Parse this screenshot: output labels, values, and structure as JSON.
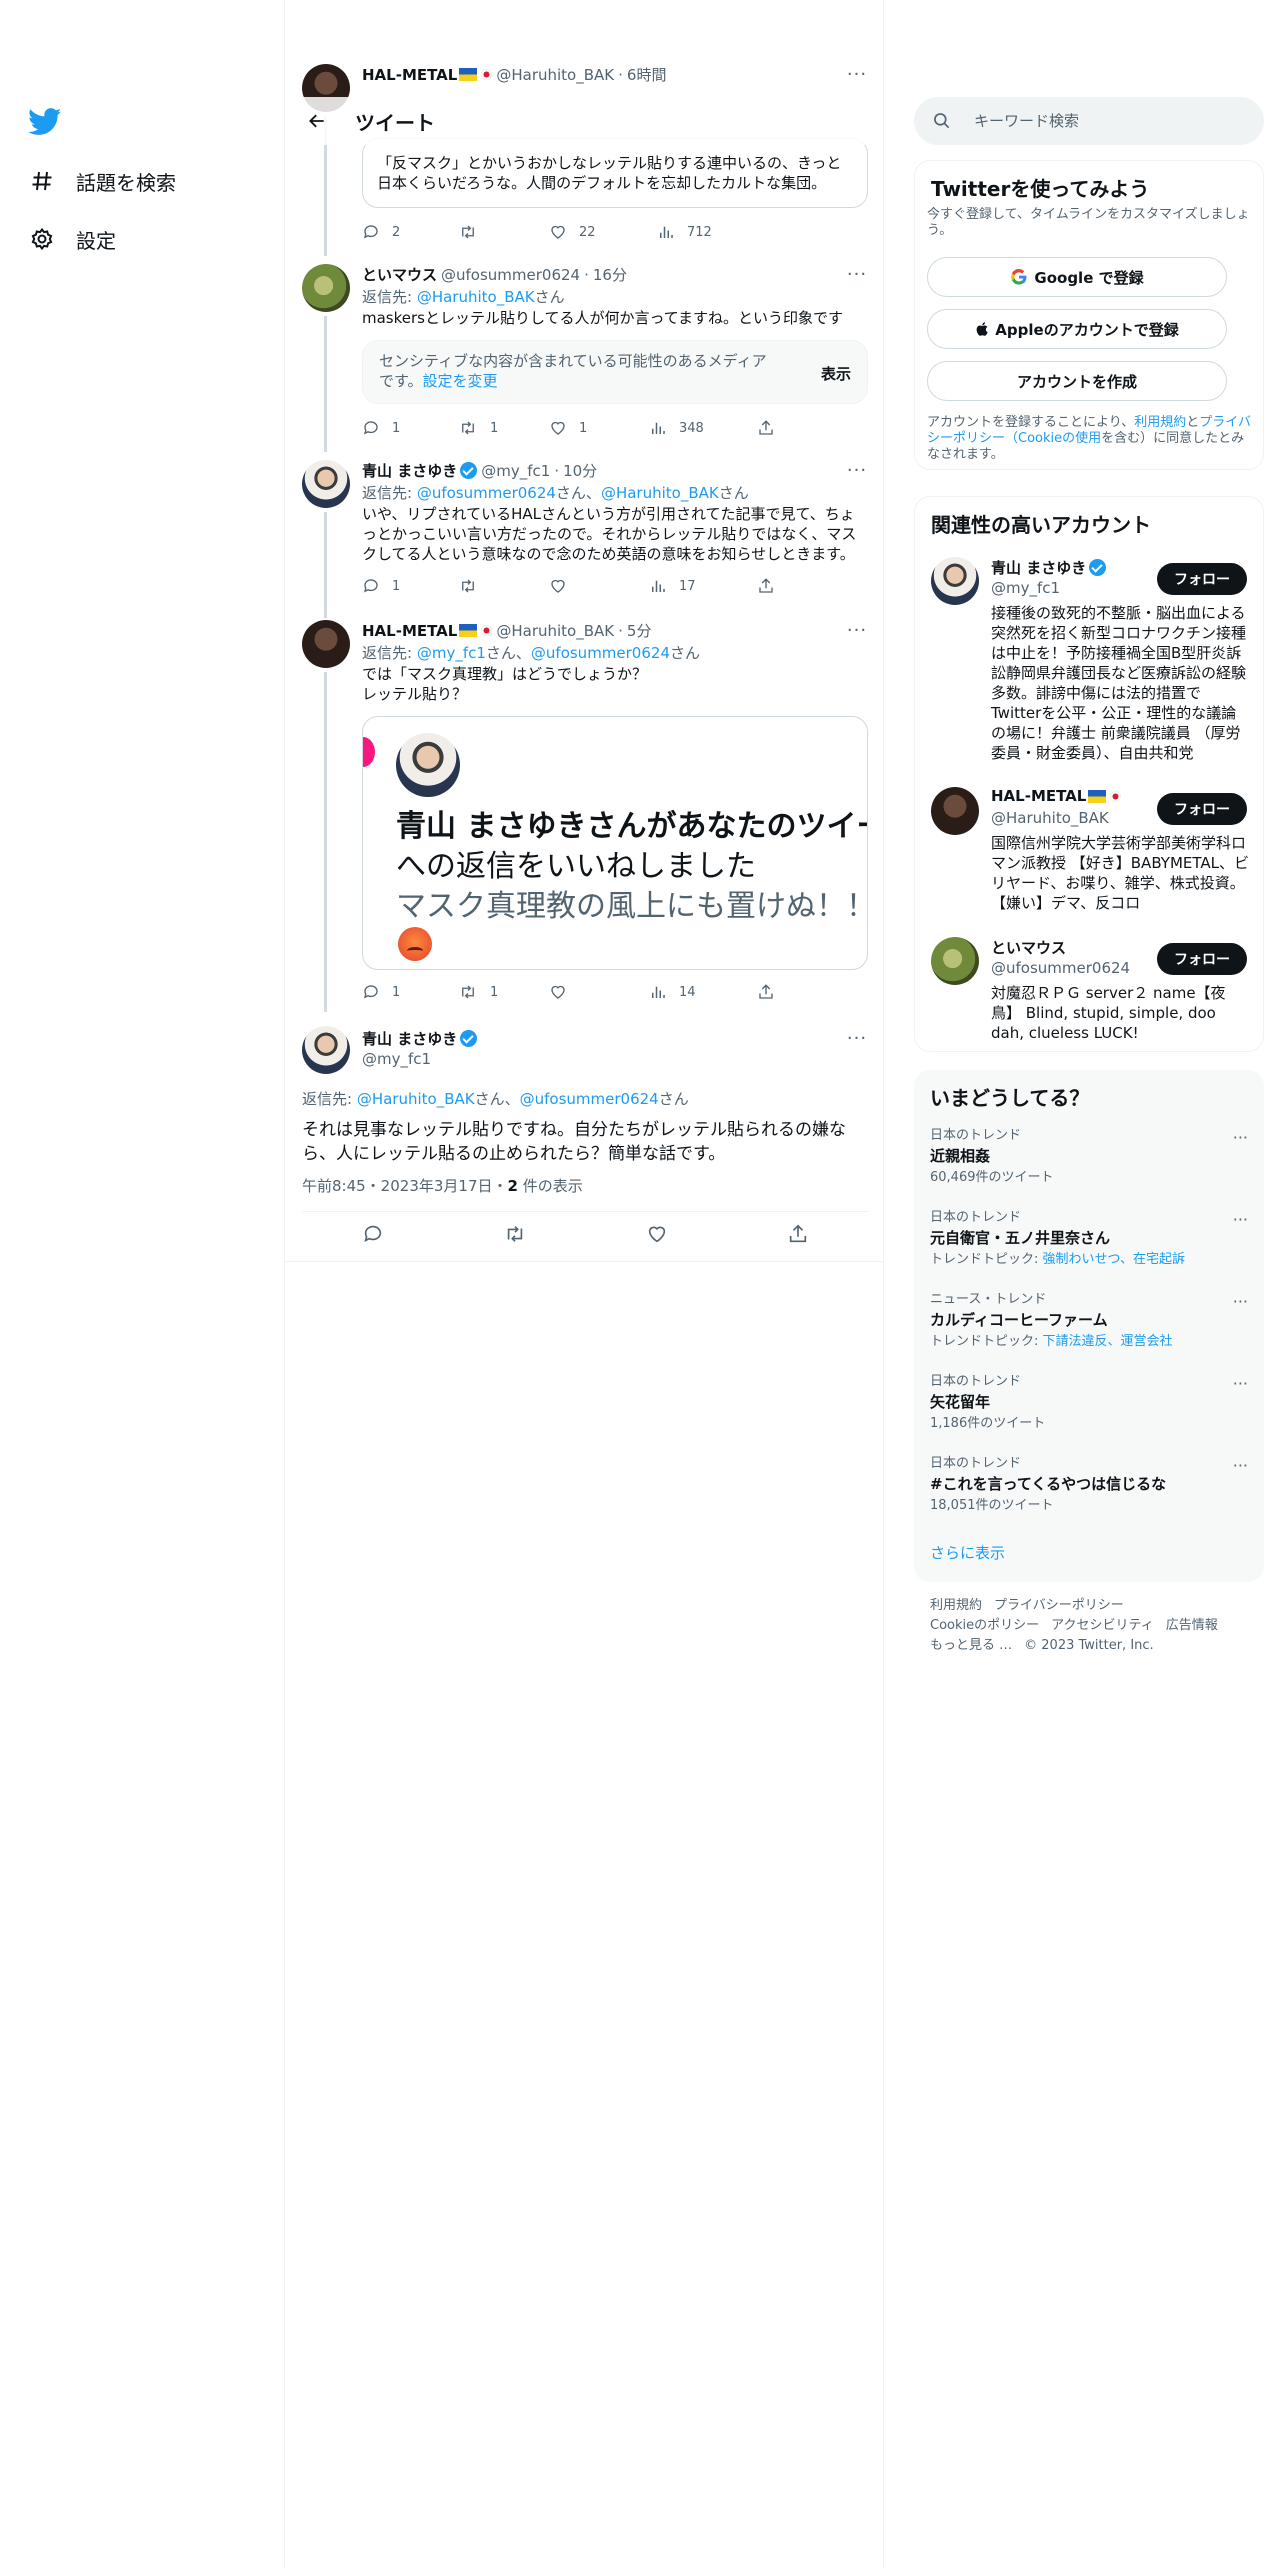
{
  "nav": {
    "explore": "話題を検索",
    "settings": "設定"
  },
  "header": {
    "title": "ツイート"
  },
  "thread": {
    "t1": {
      "name": "HAL-METAL",
      "handle": "@Haruhito_BAK",
      "time": "6時間",
      "quote_text": "「反マスク」とかいうおかしなレッテル貼りする連中いるの、きっと日本くらいだろうな。人間のデフォルトを忘却したカルトな集団。",
      "replies": "2",
      "retweets": "",
      "likes": "22",
      "views": "712"
    },
    "t2": {
      "name": "といマウス",
      "handle": "@ufosummer0624",
      "time": "16分",
      "reply_prefix": "返信先: ",
      "reply_link": "@Haruhito_BAK",
      "reply_suffix": "さん",
      "body": "maskersとレッテル貼りしてる人が何か言ってますね。という印象です",
      "sensitive_text": "センシティブな内容が含まれている可能性のあるメディアです。",
      "sensitive_link": "設定を変更",
      "show": "表示",
      "replies": "1",
      "retweets": "1",
      "likes": "1",
      "views": "348"
    },
    "t3": {
      "name": "青山 まさゆき",
      "handle": "@my_fc1",
      "time": "10分",
      "reply_prefix": "返信先: ",
      "reply_link1": "@ufosummer0624",
      "reply_mid": "さん、",
      "reply_link2": "@Haruhito_BAK",
      "reply_suffix": "さん",
      "body": "いや、リプされているHALさんという方が引用されてた記事で見て、ちょっとかっこいい言い方だったので。それからレッテル貼りではなく、マスクしてる人という意味なので念のため英語の意味をお知らせしときます。",
      "replies": "1",
      "retweets": "",
      "likes": "",
      "views": "17"
    },
    "t4": {
      "name": "HAL-METAL",
      "handle": "@Haruhito_BAK",
      "time": "5分",
      "reply_prefix": "返信先: ",
      "reply_link1": "@my_fc1",
      "reply_mid": "さん、",
      "reply_link2": "@ufosummer0624",
      "reply_suffix": "さん",
      "body_line1": "では「マスク真理教」はどうでしょうか？",
      "body_line2": "レッテル貼り？",
      "img_line1": "青山 まさゆきさんがあなたのツイー",
      "img_line2": "への返信をいいねしました",
      "img_line3": "マスク真理教の風上にも置けぬ！！",
      "replies": "1",
      "retweets": "1",
      "likes": "",
      "views": "14"
    },
    "main": {
      "name": "青山 まさゆき",
      "handle": "@my_fc1",
      "reply_prefix": "返信先: ",
      "reply_link1": "@Haruhito_BAK",
      "reply_mid": "さん、",
      "reply_link2": "@ufosummer0624",
      "reply_suffix": "さん",
      "body": "それは見事なレッテル貼りですね。自分たちがレッテル貼られるの嫌なら、人にレッテル貼るの止められたら？簡単な話です。",
      "time": "午前8:45・2023年3月17日・",
      "views_count": "2",
      "views_label": " 件の表示"
    }
  },
  "right": {
    "search_placeholder": "キーワード検索",
    "signup": {
      "title": "Twitterを使ってみよう",
      "subtitle": "今すぐ登録して、タイムラインをカスタマイズしましょう。",
      "google": "Google で登録",
      "apple": "Appleのアカウントで登録",
      "create": "アカウントを作成",
      "terms_1": "アカウントを登録することにより、",
      "terms_link1": "利用規約",
      "terms_2": "と",
      "terms_link2": "プライバシーポリシー（Cookieの使用",
      "terms_3": "を含む）に同意したとみなされます。"
    },
    "related": {
      "title": "関連性の高いアカウント",
      "follow": "フォロー",
      "accounts": [
        {
          "name": "青山 まさゆき",
          "handle": "@my_fc1",
          "bio": "接種後の致死的不整脈・脳出血による突然死を招く新型コロナワクチン接種は中止を！予防接種禍全国B型肝炎訴訟静岡県弁護団長など医療訴訟の経験多数。誹謗中傷には法的措置でTwitterを公平・公正・理性的な議論の場に！弁護士 前衆議院議員 （厚労委員・財金委員）、自由共和党"
        },
        {
          "name": "HAL-METAL",
          "handle": "@Haruhito_BAK",
          "bio": "国際信州学院大学芸術学部美術学科ロマン派教授 【好き】BABYMETAL、ビリヤード、お喋り、雑学、株式投資。【嫌い】デマ、反コロ"
        },
        {
          "name": "といマウス",
          "handle": "@ufosummer0624",
          "bio": "対魔忍ＲＰＧ server２ name【夜鳥】 Blind, stupid, simple, doo dah, clueless LUCK!"
        }
      ]
    },
    "trends": {
      "title": "いまどうしてる？",
      "items": [
        {
          "cat": "日本のトレンド",
          "name": "近親相姦",
          "sub": "60,469件のツイート"
        },
        {
          "cat": "日本のトレンド",
          "name": "元自衛官・五ノ井里奈さん",
          "sub_prefix": "トレンドトピック: ",
          "sub_link": "強制わいせつ、在宅起訴"
        },
        {
          "cat": "ニュース・トレンド",
          "name": "カルディコーヒーファーム",
          "sub_prefix": "トレンドトピック: ",
          "sub_link": "下請法違反、運営会社"
        },
        {
          "cat": "日本のトレンド",
          "name": "矢花留年",
          "sub": "1,186件のツイート"
        },
        {
          "cat": "日本のトレンド",
          "name": "#これを言ってくるやつは信じるな",
          "sub": "18,051件のツイート"
        }
      ],
      "more": "さらに表示"
    },
    "footer": {
      "terms": "利用規約",
      "privacy": "プライバシーポリシー",
      "cookie": "Cookieのポリシー",
      "access": "アクセシビリティ",
      "ads": "広告情報",
      "more": "もっと見る …",
      "copy": "© 2023 Twitter, Inc."
    }
  },
  "colors": {
    "accent": "#1d9bf0",
    "text": "#0f1419",
    "muted": "#536471"
  }
}
